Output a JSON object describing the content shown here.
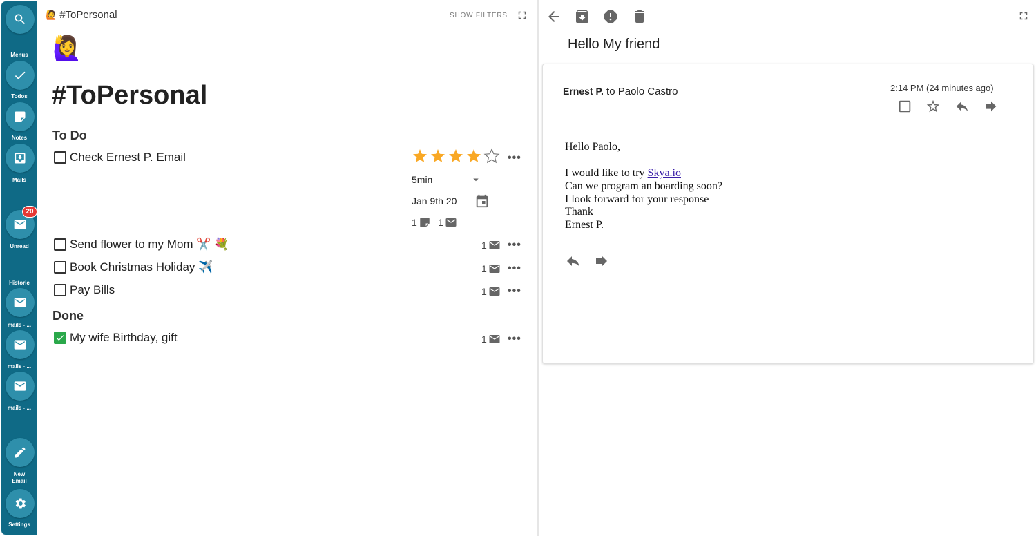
{
  "sidebar": {
    "menus_label": "Menus",
    "todos_label": "Todos",
    "notes_label": "Notes",
    "mails_label": "Mails",
    "unread_label": "Unread",
    "unread_badge": "20",
    "historic_label": "Historic",
    "history_items": [
      "mails - ...",
      "mails - ...",
      "mails - ..."
    ],
    "new_email_label_1": "New",
    "new_email_label_2": "Email",
    "settings_label": "Settings"
  },
  "left": {
    "header_emoji": "🙋",
    "header_title": "#ToPersonal",
    "show_filters": "SHOW FILTERS",
    "big_emoji": "🙋‍♀️",
    "big_title": "#ToPersonal",
    "todo_heading": "To Do",
    "done_heading": "Done",
    "todos": [
      {
        "label": "Check Ernest P. Email",
        "mail_count": "1",
        "doc_count": "1"
      },
      {
        "label": "Send flower to my Mom ✂️ 💐",
        "mail_count": "1"
      },
      {
        "label": "Book Christmas Holiday ✈️",
        "mail_count": "1"
      },
      {
        "label": "Pay Bills",
        "mail_count": "1"
      }
    ],
    "done": [
      {
        "label": "My wife Birthday, gift",
        "mail_count": "1"
      }
    ],
    "rating": 4,
    "rating_max": 5,
    "duration": "5min",
    "due_date": "Jan 9th 20",
    "more": "•••"
  },
  "right": {
    "subject": "Hello My friend",
    "from_name": "Ernest P.",
    "to_text": " to Paolo Castro",
    "time": "2:14 PM (24 minutes ago)",
    "body": {
      "greeting": "Hello Paolo,",
      "line1_prefix": "I would like to try ",
      "line1_link": "Skya.io",
      "line2": "Can we program an boarding soon?",
      "line3": "I look forward for your response",
      "line4": "Thank",
      "line5": "Ernest P."
    }
  },
  "colors": {
    "sidebar_bg": "#0f6a86",
    "sidebar_button": "#2e8fab",
    "badge": "#e53935",
    "star": "#f9a825",
    "done_check": "#2aa84a"
  }
}
